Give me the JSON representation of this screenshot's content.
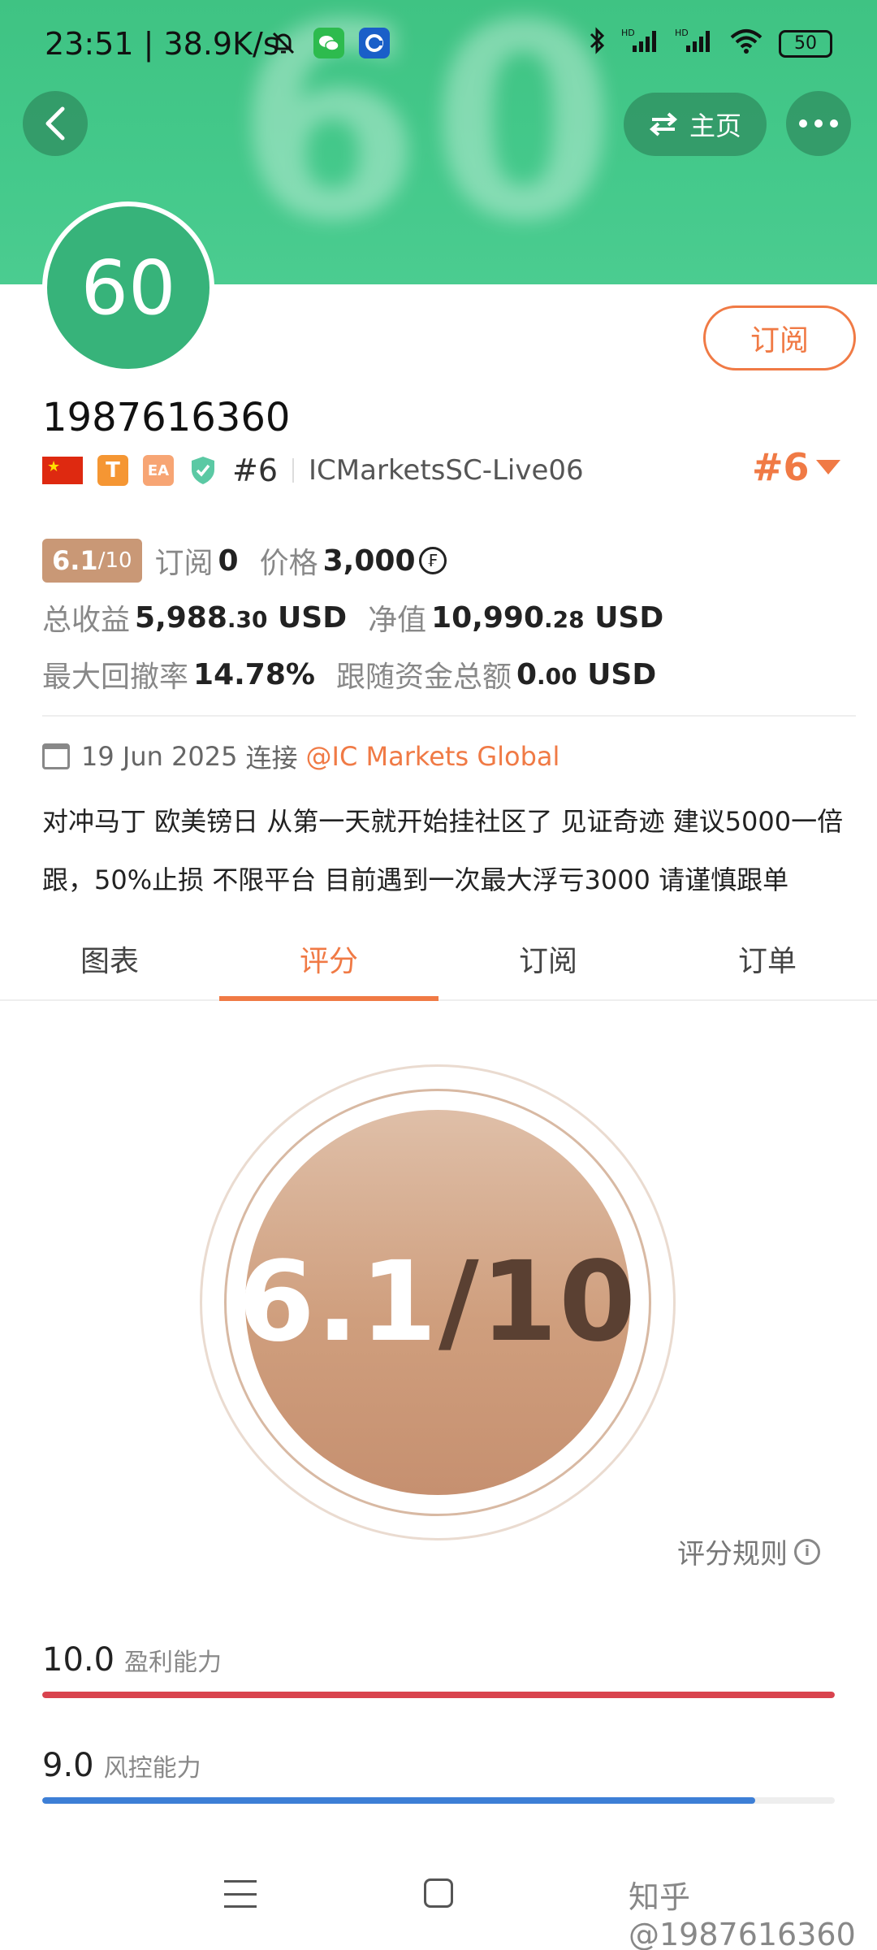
{
  "status_bar": {
    "time": "23:51",
    "speed": "38.9K/s",
    "battery": "50"
  },
  "header": {
    "banner_text": "60",
    "home_label": "主页"
  },
  "profile": {
    "avatar_text": "60",
    "subscribe_label": "订阅",
    "account_id": "1987616360",
    "tag_t": "T",
    "tag_ea": "EA",
    "rank_small": "#6",
    "server": "ICMarketsSC-Live06",
    "rank_big": "#6"
  },
  "stats": {
    "score_main": "6.1",
    "score_denom": "/10",
    "subscribe_label": "订阅",
    "subscribe_count": "0",
    "price_label": "价格",
    "price_value": "3,000",
    "total_profit_label": "总收益",
    "total_profit_int": "5,988",
    "total_profit_dec": ".30",
    "total_profit_unit": "USD",
    "equity_label": "净值",
    "equity_int": "10,990",
    "equity_dec": ".28",
    "equity_unit": "USD",
    "max_dd_label": "最大回撤率",
    "max_dd_value": "14.78%",
    "follow_label": "跟随资金总额",
    "follow_int": "0",
    "follow_dec": ".00",
    "follow_unit": "USD"
  },
  "connection": {
    "date": "19 Jun 2025",
    "connect_label": "连接",
    "broker": "@IC Markets Global"
  },
  "description": "对冲马丁 欧美镑日 从第一天就开始挂社区了 见证奇迹 建议5000一倍跟，50%止损 不限平台 目前遇到一次最大浮亏3000 请谨慎跟单",
  "tabs": [
    "图表",
    "评分",
    "订阅",
    "订单"
  ],
  "active_tab": 1,
  "score": {
    "main": "6.1",
    "denom": "/10",
    "rules_label": "评分规则"
  },
  "metrics": [
    {
      "value": "10.0",
      "name": "盈利能力",
      "fraction": 1.0,
      "color": "#d9434e"
    },
    {
      "value": "9.0",
      "name": "风控能力",
      "fraction": 0.9,
      "color": "#3d7fd6"
    }
  ],
  "watermark": "知乎 @1987616360"
}
